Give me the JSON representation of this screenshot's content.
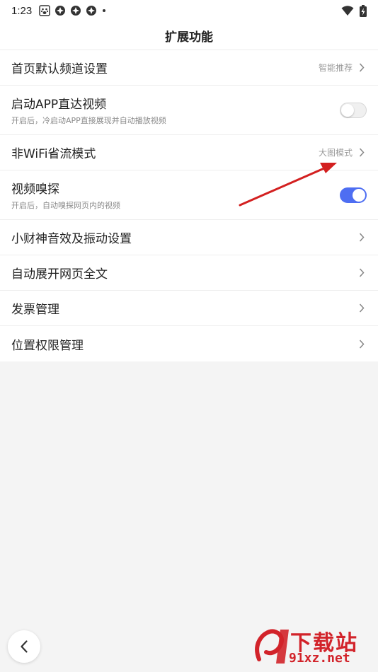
{
  "status_bar": {
    "time": "1:23",
    "left_icons": [
      "baidu-icon",
      "pinwheel-icon",
      "pinwheel-icon",
      "pinwheel-icon",
      "dot-icon"
    ],
    "right_icons": [
      "wifi-icon",
      "battery-charging-icon"
    ]
  },
  "header": {
    "title": "扩展功能"
  },
  "settings": {
    "items": [
      {
        "label": "首页默认频道设置",
        "value": "智能推荐"
      },
      {
        "label": "启动APP直达视频",
        "sub": "开启后，冷启动APP直接展现并自动播放视频",
        "toggle": "off"
      },
      {
        "label": "非WiFi省流模式",
        "value": "大图模式"
      },
      {
        "label": "视频嗅探",
        "sub": "开启后，自动嗅探网页内的视频",
        "toggle": "on"
      },
      {
        "label": "小财神音效及振动设置"
      },
      {
        "label": "自动展开网页全文"
      },
      {
        "label": "发票管理"
      },
      {
        "label": "位置权限管理"
      }
    ]
  },
  "watermark": {
    "top_text": "下载站",
    "bottom_text": "91xz.net"
  },
  "colors": {
    "accent": "#4e6ef2",
    "annotation_arrow": "#d32020",
    "watermark": "#d2232a"
  }
}
